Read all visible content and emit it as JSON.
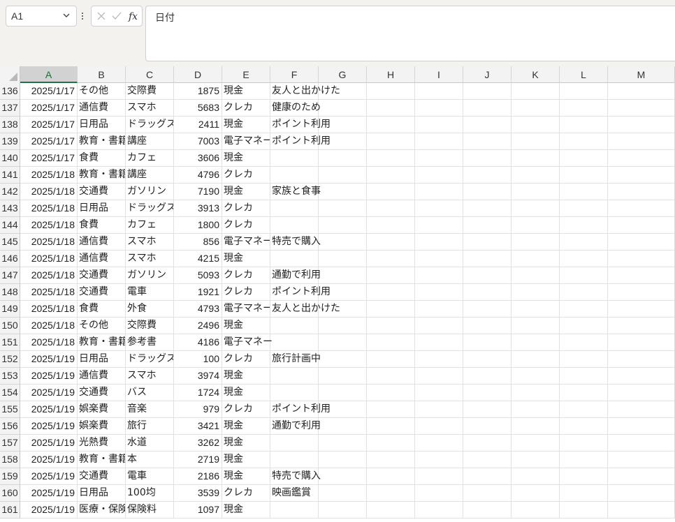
{
  "formula_bar": {
    "name_box": "A1",
    "content": "日付",
    "cancel_icon": "cancel-icon",
    "enter_icon": "check-icon",
    "function_icon": "fx-icon"
  },
  "columns": [
    "A",
    "B",
    "C",
    "D",
    "E",
    "F",
    "G",
    "H",
    "I",
    "J",
    "K",
    "L",
    "M"
  ],
  "selected_column": "A",
  "rows": [
    {
      "n": "136",
      "date": "2025/1/17",
      "cat": "その他",
      "item": "交際費",
      "amount": "1875",
      "pay": "現金",
      "note": "友人と出かけた"
    },
    {
      "n": "137",
      "date": "2025/1/17",
      "cat": "通信費",
      "item": "スマホ",
      "amount": "5683",
      "pay": "クレカ",
      "note": "健康のため"
    },
    {
      "n": "138",
      "date": "2025/1/17",
      "cat": "日用品",
      "item": "ドラッグストア",
      "amount": "2411",
      "pay": "現金",
      "note": "ポイント利用"
    },
    {
      "n": "139",
      "date": "2025/1/17",
      "cat": "教育・書籍",
      "item": "講座",
      "amount": "7003",
      "pay": "電子マネー",
      "note": "ポイント利用"
    },
    {
      "n": "140",
      "date": "2025/1/17",
      "cat": "食費",
      "item": "カフェ",
      "amount": "3606",
      "pay": "現金",
      "note": ""
    },
    {
      "n": "141",
      "date": "2025/1/18",
      "cat": "教育・書籍",
      "item": "講座",
      "amount": "4796",
      "pay": "クレカ",
      "note": ""
    },
    {
      "n": "142",
      "date": "2025/1/18",
      "cat": "交通費",
      "item": "ガソリン",
      "amount": "7190",
      "pay": "現金",
      "note": "家族と食事"
    },
    {
      "n": "143",
      "date": "2025/1/18",
      "cat": "日用品",
      "item": "ドラッグストア",
      "amount": "3913",
      "pay": "クレカ",
      "note": ""
    },
    {
      "n": "144",
      "date": "2025/1/18",
      "cat": "食費",
      "item": "カフェ",
      "amount": "1800",
      "pay": "クレカ",
      "note": ""
    },
    {
      "n": "145",
      "date": "2025/1/18",
      "cat": "通信費",
      "item": "スマホ",
      "amount": "856",
      "pay": "電子マネー",
      "note": "特売で購入"
    },
    {
      "n": "146",
      "date": "2025/1/18",
      "cat": "通信費",
      "item": "スマホ",
      "amount": "4215",
      "pay": "現金",
      "note": ""
    },
    {
      "n": "147",
      "date": "2025/1/18",
      "cat": "交通費",
      "item": "ガソリン",
      "amount": "5093",
      "pay": "クレカ",
      "note": "通勤で利用"
    },
    {
      "n": "148",
      "date": "2025/1/18",
      "cat": "交通費",
      "item": "電車",
      "amount": "1921",
      "pay": "クレカ",
      "note": "ポイント利用"
    },
    {
      "n": "149",
      "date": "2025/1/18",
      "cat": "食費",
      "item": "外食",
      "amount": "4793",
      "pay": "電子マネー",
      "note": "友人と出かけた"
    },
    {
      "n": "150",
      "date": "2025/1/18",
      "cat": "その他",
      "item": "交際費",
      "amount": "2496",
      "pay": "現金",
      "note": ""
    },
    {
      "n": "151",
      "date": "2025/1/18",
      "cat": "教育・書籍",
      "item": "参考書",
      "amount": "4186",
      "pay": "電子マネー",
      "note": ""
    },
    {
      "n": "152",
      "date": "2025/1/19",
      "cat": "日用品",
      "item": "ドラッグストア",
      "amount": "100",
      "pay": "クレカ",
      "note": "旅行計画中"
    },
    {
      "n": "153",
      "date": "2025/1/19",
      "cat": "通信費",
      "item": "スマホ",
      "amount": "3974",
      "pay": "現金",
      "note": ""
    },
    {
      "n": "154",
      "date": "2025/1/19",
      "cat": "交通費",
      "item": "バス",
      "amount": "1724",
      "pay": "現金",
      "note": ""
    },
    {
      "n": "155",
      "date": "2025/1/19",
      "cat": "娯楽費",
      "item": "音楽",
      "amount": "979",
      "pay": "クレカ",
      "note": "ポイント利用"
    },
    {
      "n": "156",
      "date": "2025/1/19",
      "cat": "娯楽費",
      "item": "旅行",
      "amount": "3421",
      "pay": "現金",
      "note": "通勤で利用"
    },
    {
      "n": "157",
      "date": "2025/1/19",
      "cat": "光熱費",
      "item": "水道",
      "amount": "3262",
      "pay": "現金",
      "note": ""
    },
    {
      "n": "158",
      "date": "2025/1/19",
      "cat": "教育・書籍",
      "item": "本",
      "amount": "2719",
      "pay": "現金",
      "note": ""
    },
    {
      "n": "159",
      "date": "2025/1/19",
      "cat": "交通費",
      "item": "電車",
      "amount": "2186",
      "pay": "現金",
      "note": "特売で購入"
    },
    {
      "n": "160",
      "date": "2025/1/19",
      "cat": "日用品",
      "item": "100均",
      "amount": "3539",
      "pay": "クレカ",
      "note": "映画鑑賞"
    },
    {
      "n": "161",
      "date": "2025/1/19",
      "cat": "医療・保険",
      "item": "保険料",
      "amount": "1097",
      "pay": "現金",
      "note": ""
    }
  ]
}
